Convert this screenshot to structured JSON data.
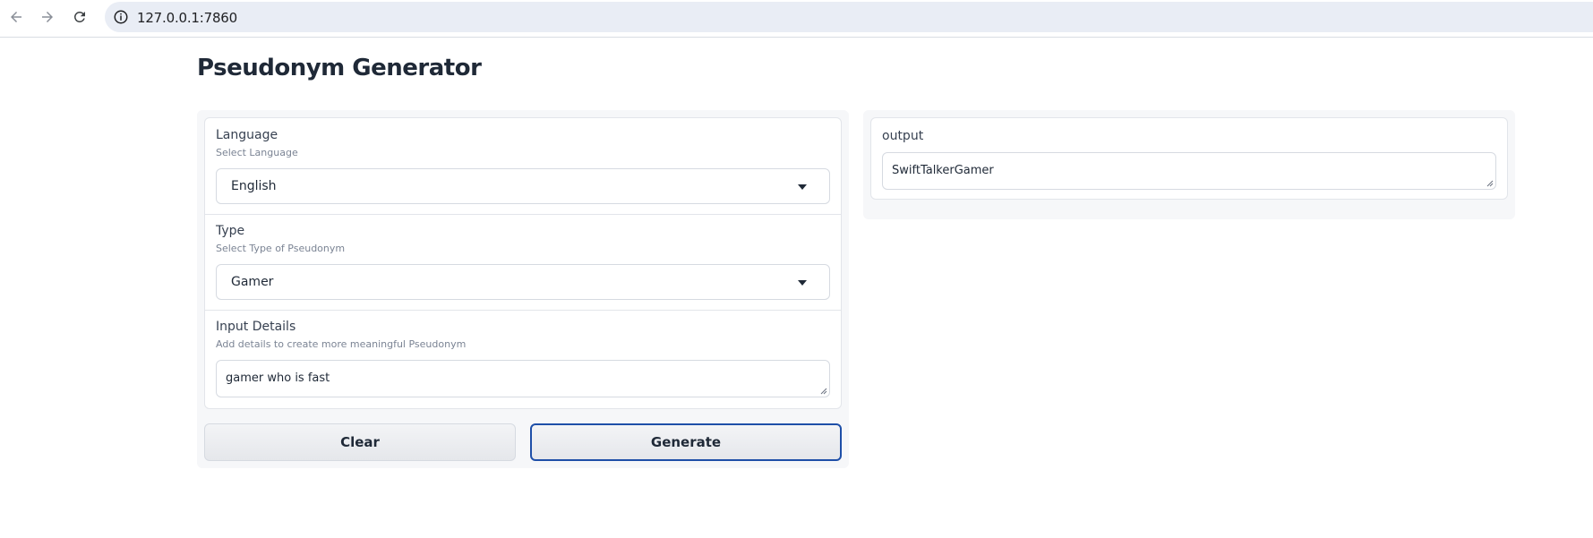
{
  "browser": {
    "url": "127.0.0.1:7860",
    "back_icon": "arrow-left-icon",
    "forward_icon": "arrow-right-icon",
    "reload_icon": "reload-icon",
    "info_icon": "info-icon"
  },
  "page": {
    "title": "Pseudonym Generator"
  },
  "form": {
    "language": {
      "label": "Language",
      "info": "Select Language",
      "value": "English"
    },
    "type": {
      "label": "Type",
      "info": "Select Type of Pseudonym",
      "value": "Gamer"
    },
    "details": {
      "label": "Input Details",
      "info": "Add details to create more meaningful Pseudonym",
      "value": "gamer who is fast"
    }
  },
  "buttons": {
    "clear": "Clear",
    "generate": "Generate"
  },
  "output": {
    "label": "output",
    "value": "SwiftTalkerGamer"
  },
  "colors": {
    "primary_border": "#1e4fa8",
    "panel_bg": "#f6f7f9",
    "url_bar_bg": "#e9edf5"
  }
}
